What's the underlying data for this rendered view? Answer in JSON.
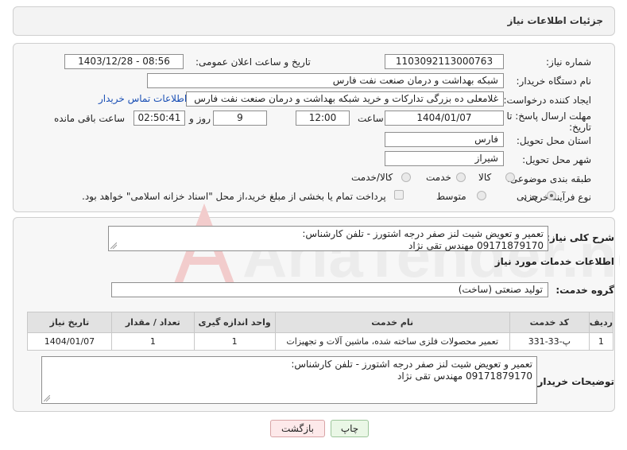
{
  "header": {
    "title": "جزئیات اطلاعات نیاز"
  },
  "form": {
    "need_number_label": "شماره نیاز:",
    "need_number": "1103092113000763",
    "announce_label": "تاریخ و ساعت اعلان عمومی:",
    "announce_value": "1403/12/28 - 08:56",
    "buyer_org_label": "نام دستگاه خریدار:",
    "buyer_org": "شبکه بهداشت و درمان صنعت نفت فارس",
    "creator_label": "ایجاد کننده درخواست:",
    "creator": "غلامعلی ده بزرگی تدارکات و خرید شبکه بهداشت و درمان صنعت نفت فارس",
    "contact_link": "اطلاعات تماس خریدار",
    "deadline_label_1": "مهلت ارسال پاسخ: تا",
    "deadline_label_2": "تاریخ:",
    "deadline_date": "1404/01/07",
    "time_label": "ساعت",
    "deadline_time": "12:00",
    "days_value": "9",
    "days_label": "روز و",
    "remaining_time": "02:50:41",
    "remaining_label": "ساعت باقی مانده",
    "province_label": "استان محل تحویل:",
    "province": "فارس",
    "city_label": "شهر محل تحویل:",
    "city": "شیراز",
    "category_label": "طبقه بندی موضوعی:",
    "category_options": [
      "کالا",
      "خدمت",
      "کالا/خدمت"
    ],
    "category_selected": "خدمت",
    "process_label": "نوع فرآیند خرید :",
    "process_options": [
      "جزیی",
      "متوسط"
    ],
    "process_selected": "جزیی",
    "treasury_note": "پرداخت تمام یا بخشی از مبلغ خرید،از محل \"اسناد خزانه اسلامی\" خواهد بود."
  },
  "details": {
    "summary_label": "شرح کلی نیاز:",
    "summary_line1": "تعمیر و تعویض شیت لنز صفر درجه اشتورز - تلفن کارشناس:",
    "summary_line2": "09171879170 مهندس تقی نژاد",
    "services_title": "اطلاعات خدمات مورد نیاز",
    "group_label": "گروه خدمت:",
    "group_value": "تولید صنعتی (ساخت)",
    "table": {
      "headers": [
        "ردیف",
        "کد خدمت",
        "نام خدمت",
        "واحد اندازه گیری",
        "تعداد / مقدار",
        "تاریخ نیاز"
      ],
      "rows": [
        [
          "1",
          "پ-33-331",
          "تعمیر محصولات فلزی ساخته شده، ماشین آلات و تجهیزات",
          "1",
          "1",
          "1404/01/07"
        ]
      ]
    },
    "buyer_notes_label": "توضیحات خریدار:",
    "buyer_notes_line1": "تعمیر و تعویض شیت لنز صفر درجه اشتورز - تلفن کارشناس:",
    "buyer_notes_line2": "09171879170 مهندس تقی نژاد"
  },
  "buttons": {
    "print": "چاپ",
    "back": "بازگشت"
  },
  "watermark": {
    "text": "AriaTender.neT"
  }
}
